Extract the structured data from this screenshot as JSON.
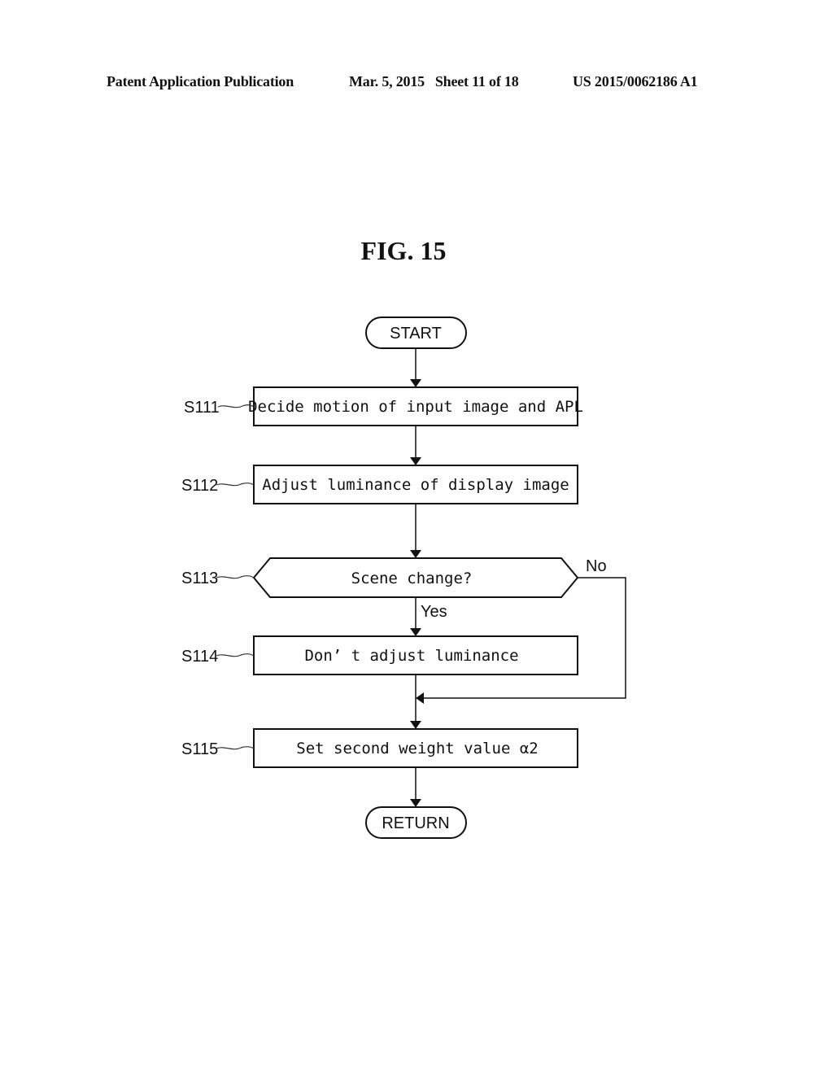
{
  "header": {
    "publication": "Patent Application Publication",
    "date_sheet": "Mar. 5, 2015   Sheet 11 of 18",
    "pub_number": "US 2015/0062186 A1"
  },
  "figure": {
    "title": "FIG. 15"
  },
  "flowchart": {
    "start": "START",
    "end": "RETURN",
    "steps": [
      {
        "id": "S111",
        "text": "Decide motion of input image and APL",
        "type": "process"
      },
      {
        "id": "S112",
        "text": "Adjust luminance of display image",
        "type": "process"
      },
      {
        "id": "S113",
        "text": "Scene change?",
        "type": "decision"
      },
      {
        "id": "S114",
        "text": "Don’ t adjust luminance",
        "type": "process"
      },
      {
        "id": "S115",
        "text": "Set second weight value α2",
        "type": "process"
      }
    ],
    "branches": {
      "yes": "Yes",
      "no": "No"
    }
  }
}
